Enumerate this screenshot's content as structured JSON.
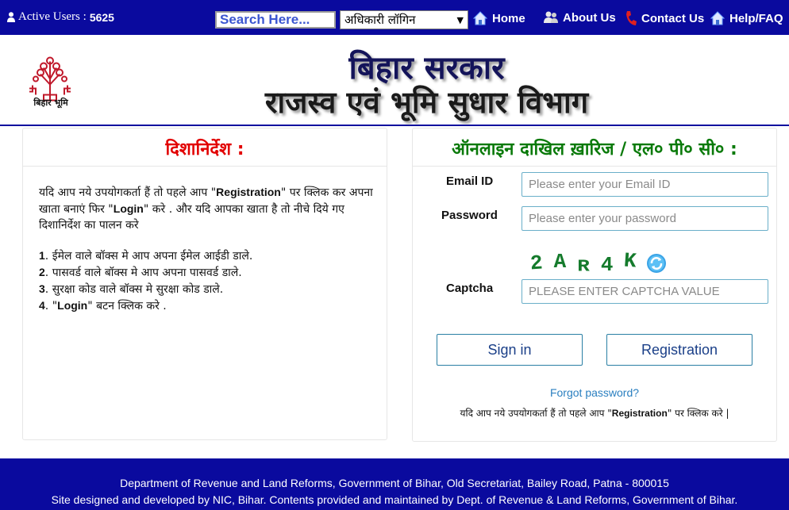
{
  "topbar": {
    "active_users_label": "Active Users :",
    "active_users_count": "5625",
    "search_placeholder": "Search Here...",
    "login_select_value": "अधिकारी लॉगिन",
    "nav": {
      "home": "Home",
      "about": "About Us",
      "contact": "Contact Us",
      "help": "Help/FAQ"
    }
  },
  "header": {
    "logo_text": "बिहार भूमि",
    "title_line1": "बिहार सरकार",
    "title_line2": "राजस्व एवं भूमि सुधार विभाग"
  },
  "instructions": {
    "title": "दिशानिर्देश :",
    "intro_1": "यदि आप नये उपयोगकर्ता हैं तो पहले आप \"",
    "intro_reg": "Registration",
    "intro_2": "\" पर क्लिक कर अपना खाता बनाएं फिर \"",
    "intro_login": "Login",
    "intro_3": "\" करे . और यदि आपका खाता है तो नीचे दिये गए दिशानिर्देश का पालन करे",
    "steps": [
      {
        "num": "1",
        "text": ". ईमेल वाले बॉक्स मे आप अपना ईमेल आईडी डाले."
      },
      {
        "num": "2",
        "text": ". पासवर्ड वाले बॉक्स मे आप अपना पासवर्ड डाले."
      },
      {
        "num": "3",
        "text": ". सुरक्षा कोड वाले बॉक्स मे सुरक्षा कोड डाले."
      },
      {
        "num": "4",
        "pre": ". \"",
        "bold": "Login",
        "text": "\" बटन क्लिक करे ."
      }
    ]
  },
  "login": {
    "title": "ऑनलाइन दाखिल ख़ारिज / एल० पी० सी० :",
    "email_label": "Email ID",
    "email_placeholder": "Please enter your Email ID",
    "password_label": "Password",
    "password_placeholder": "Please enter your password",
    "captcha_label": "Captcha",
    "captcha_chars": [
      "2",
      "A",
      "R",
      "4",
      "K"
    ],
    "captcha_placeholder": "PLEASE ENTER CAPTCHA VALUE",
    "signin_label": "Sign in",
    "registration_label": "Registration",
    "forgot_label": "Forgot password?",
    "note_pre": "यदि आप नये उपयोगकर्ता हैं तो पहले आप \"",
    "note_bold": "Registration",
    "note_post": "\" पर क्लिक करे |"
  },
  "footer": {
    "line1": "Department of Revenue and Land Reforms, Government of Bihar, Old Secretariat, Bailey Road, Patna - 800015",
    "line2": "Site designed and developed by NIC, Bihar. Contents provided and maintained by Dept. of Revenue & Land Reforms, Government of Bihar."
  },
  "colors": {
    "navy": "#0a0a9e",
    "red_title": "#e20000",
    "green_title": "#0a7a0a",
    "captcha_green": "#157b2c"
  }
}
